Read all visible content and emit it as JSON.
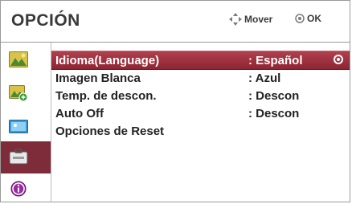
{
  "header": {
    "title": "OPCIÓN",
    "move_label": "Mover",
    "ok_label": "OK"
  },
  "sidebar": {
    "items": [
      {
        "icon": "picture-icon",
        "selected": false
      },
      {
        "icon": "picture-plus-icon",
        "selected": false
      },
      {
        "icon": "screen-icon",
        "selected": false
      },
      {
        "icon": "toolbox-icon",
        "selected": true
      },
      {
        "icon": "info-icon",
        "selected": false
      }
    ]
  },
  "menu": {
    "rows": [
      {
        "label": "Idioma(Language)",
        "value": ": Español",
        "selected": true
      },
      {
        "label": "Imagen Blanca",
        "value": ": Azul",
        "selected": false
      },
      {
        "label": "Temp. de descon.",
        "value": ": Descon",
        "selected": false
      },
      {
        "label": "Auto Off",
        "value": ": Descon",
        "selected": false
      },
      {
        "label": "Opciones de Reset",
        "value": "",
        "selected": false
      }
    ]
  },
  "colors": {
    "accent": "#9a2f3d",
    "selected_sidebar": "#7e2b3a",
    "text": "#222222"
  }
}
